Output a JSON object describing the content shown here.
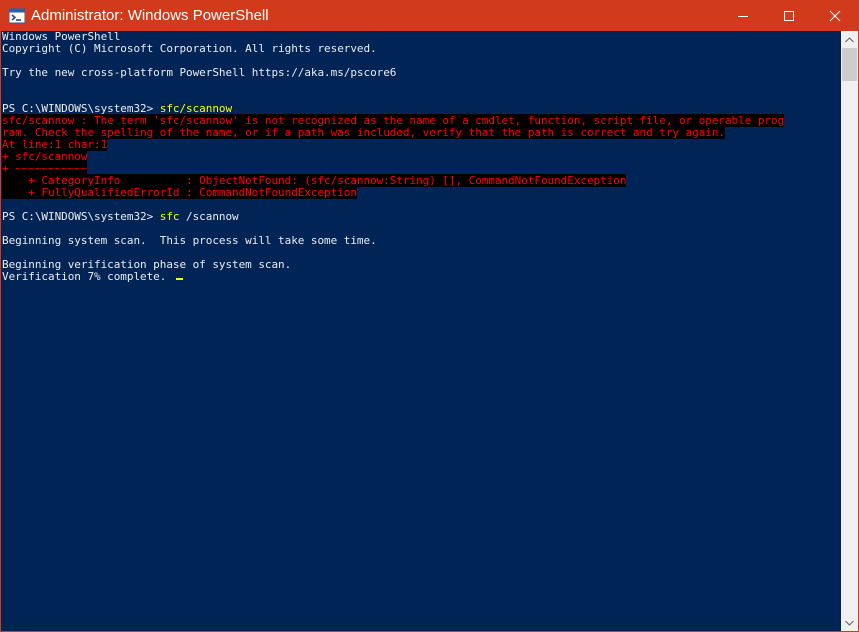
{
  "window": {
    "title": "Administrator: Windows PowerShell",
    "accent_color": "#d23a1c",
    "background_color": "#012456",
    "icons": {
      "app": "powershell-icon",
      "minimize": "minimize-icon",
      "maximize": "maximize-icon",
      "close": "close-icon"
    }
  },
  "console": {
    "colors": {
      "text": "#eeedf0",
      "error": "#ff0000",
      "error_bg": "#000000",
      "command": "#ffff00"
    },
    "lines": {
      "banner1": "Windows PowerShell",
      "banner2": "Copyright (C) Microsoft Corporation. All rights reserved.",
      "banner3": "Try the new cross-platform PowerShell https://aka.ms/pscore6",
      "prompt1": "PS C:\\WINDOWS\\system32> ",
      "cmd1": "sfc/scannow",
      "err1": "sfc/scannow : The term 'sfc/scannow' is not recognized as the name of a cmdlet, function, script file, or operable prog",
      "err2": "ram. Check the spelling of the name, or if a path was included, verify that the path is correct and try again.",
      "err3": "At line:1 char:1",
      "err4": "+ sfc/scannow",
      "err5": "+ ~~~~~~~~~~~",
      "err6": "    + CategoryInfo          : ObjectNotFound: (sfc/scannow:String) [], CommandNotFoundException",
      "err7": "    + FullyQualifiedErrorId : CommandNotFoundException",
      "prompt2": "PS C:\\WINDOWS\\system32> ",
      "cmd2": "sfc",
      "cmd2_args": " /scannow",
      "out1": "Beginning system scan.  This process will take some time.",
      "out2": "Beginning verification phase of system scan.",
      "out3": "Verification 7% complete."
    }
  }
}
